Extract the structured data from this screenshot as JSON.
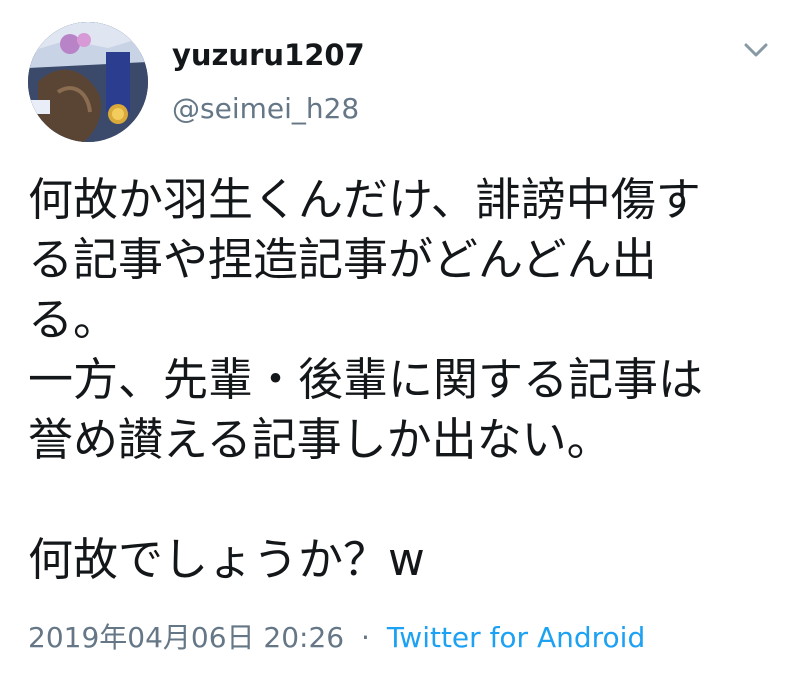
{
  "user": {
    "display_name": "yuzuru1207",
    "handle": "@seimei_h28",
    "avatar_icon": "profile-photo"
  },
  "menu": {
    "icon": "chevron-down-icon"
  },
  "tweet": {
    "lines": [
      "何故か羽生くんだけ、誹謗中傷す",
      "る記事や捏造記事がどんどん出",
      "る。",
      "一方、先輩・後輩に関する記事は",
      "誉め讃える記事しか出ない。",
      "",
      "何故でしょうか？w"
    ]
  },
  "meta": {
    "timestamp": "2019年04月06日 20:26",
    "separator": "·",
    "source": "Twitter for Android"
  },
  "colors": {
    "text": "#14171a",
    "secondary": "#657786",
    "link": "#1da1f2"
  }
}
